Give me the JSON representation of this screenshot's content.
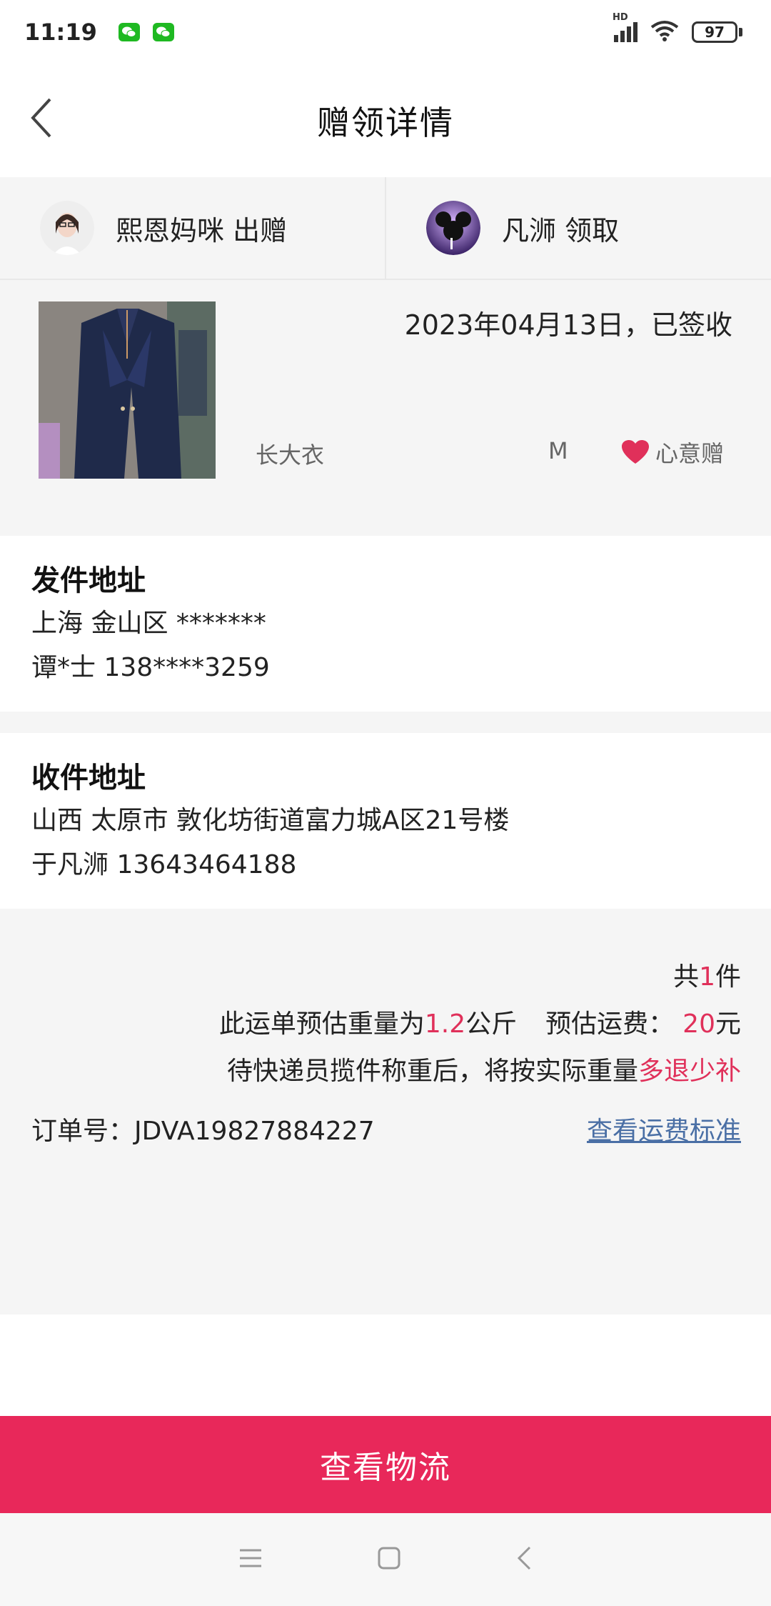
{
  "status_bar": {
    "time": "11:19",
    "battery": "97",
    "network_label": "HD",
    "icons": [
      "wechat-icon",
      "wechat-icon",
      "signal-icon",
      "wifi-icon",
      "battery-icon"
    ]
  },
  "header": {
    "title": "赠领详情",
    "back_icon": "chevron-left-icon"
  },
  "parties": {
    "giver": "熙恩妈咪 出赠",
    "receiver": "凡浉 领取"
  },
  "item": {
    "date_status": "2023年04月13日，已签收",
    "name": "长大衣",
    "size": "M",
    "badge": "心意赠",
    "badge_icon": "heart-icon"
  },
  "sender_address": {
    "title": "发件地址",
    "line1": "上海 金山区 *******",
    "line2": "谭*士 138****3259"
  },
  "receiver_address": {
    "title": "收件地址",
    "line1": "山西 太原市 敦化坊街道富力城A区21号楼",
    "line2": "于凡浉 13643464188"
  },
  "shipping": {
    "count_prefix": "共",
    "count": "1",
    "count_suffix": "件",
    "weight_prefix": "此运单预估重量为",
    "weight": "1.2",
    "weight_suffix": "公斤",
    "fee_prefix": "预估运费：",
    "fee": "20",
    "fee_suffix": "元",
    "notice_prefix": "待快递员揽件称重后，将按实际重量",
    "notice_accent": "多退少补",
    "order_label": "订单号：JDVA19827884227",
    "fee_standard_link": "查看运费标准"
  },
  "actions": {
    "logistics_button": "查看物流"
  },
  "colors": {
    "accent": "#e0305a",
    "button": "#e8285a",
    "link": "#4a6fa5",
    "panel_bg": "#f5f5f5",
    "wechat_green": "#1fb922"
  },
  "system_nav": {
    "icons": [
      "menu-icon",
      "home-icon",
      "back-icon"
    ]
  }
}
